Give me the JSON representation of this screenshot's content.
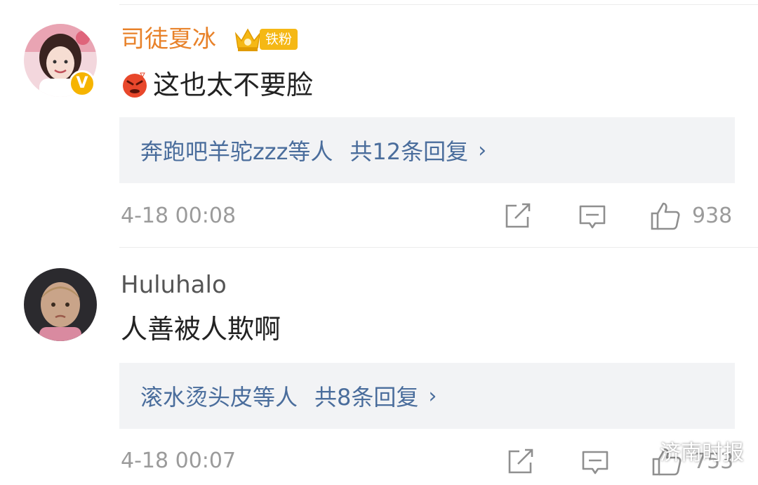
{
  "comments": [
    {
      "username": "司徒夏冰",
      "badge_label": "铁粉",
      "verified_mark": "V",
      "text": "这也太不要脸",
      "emoji": "angry-face-emoji",
      "reply_users": "奔跑吧羊驼zzz等人",
      "reply_count": "共12条回复",
      "reply_chevron": "›",
      "time": "4-18 00:08",
      "likes": "938"
    },
    {
      "username": "Huluhalo",
      "text": "人善被人欺啊",
      "reply_users": "滚水烫头皮等人",
      "reply_count": "共8条回复",
      "reply_chevron": "›",
      "time": "4-18 00:07",
      "likes": "753"
    }
  ],
  "watermark": {
    "text": "济南时报",
    "icon": "wechat-icon"
  },
  "colors": {
    "username_accent": "#e8822a",
    "link_blue": "#4a6d9c",
    "meta_gray": "#9b9b9b",
    "reply_bg": "#f2f3f5",
    "badge_gold": "#f5b815"
  }
}
